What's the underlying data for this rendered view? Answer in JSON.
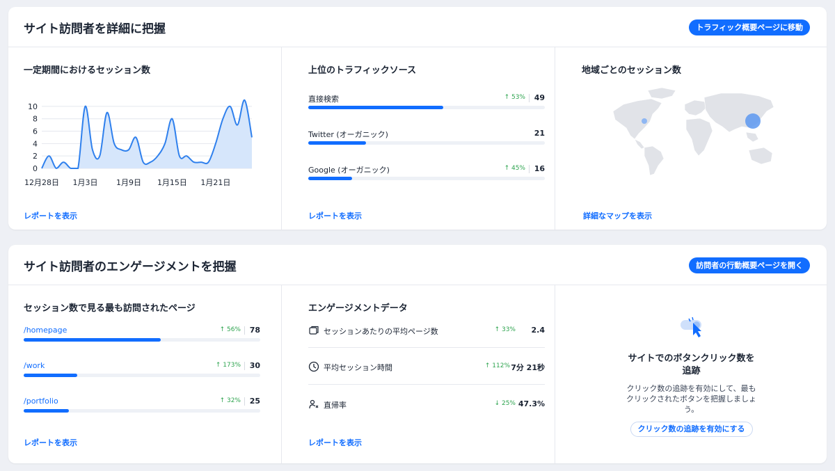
{
  "card1": {
    "title": "サイト訪問者を詳細に把握",
    "button": "トラフィック概要ページに移動",
    "sessions": {
      "title": "一定期間におけるセッション数",
      "link": "レポートを表示"
    },
    "traffic": {
      "title": "上位のトラフィックソース",
      "link": "レポートを表示",
      "rows": [
        {
          "label": "直接検索",
          "delta": "53%",
          "value": "49",
          "fill": 0.57
        },
        {
          "label": "Twitter (オーガニック)",
          "delta": "",
          "value": "21",
          "fill": 0.245
        },
        {
          "label": "Google (オーガニック)",
          "delta": "45%",
          "value": "16",
          "fill": 0.185
        }
      ]
    },
    "map": {
      "title": "地域ごとのセッション数",
      "link": "詳細なマップを表示"
    }
  },
  "card2": {
    "title": "サイト訪問者のエンゲージメントを把握",
    "button": "訪問者の行動概要ページを開く",
    "pages": {
      "title": "セッション数で見る最も訪問されたページ",
      "link": "レポートを表示",
      "rows": [
        {
          "label": "/homepage",
          "delta": "56%",
          "value": "78",
          "fill": 0.58
        },
        {
          "label": "/work",
          "delta": "173%",
          "value": "30",
          "fill": 0.225
        },
        {
          "label": "/portfolio",
          "delta": "32%",
          "value": "25",
          "fill": 0.19
        }
      ]
    },
    "engagement": {
      "title": "エンゲージメントデータ",
      "link": "レポートを表示",
      "rows": [
        {
          "icon": "pages-icon",
          "label": "セッションあたりの平均ページ数",
          "delta": "33%",
          "direction": "up",
          "value": "2.4"
        },
        {
          "icon": "clock-icon",
          "label": "平均セッション時間",
          "delta": "112%",
          "direction": "up",
          "value": "7分 21秒"
        },
        {
          "icon": "bounce-icon",
          "label": "直帰率",
          "delta": "25%",
          "direction": "down",
          "value": "47.3%"
        }
      ]
    },
    "click_tracking": {
      "title_line1": "サイトでのボタンクリック数を",
      "title_line2": "追跡",
      "desc_line1": "クリック数の追跡を有効にして、最も",
      "desc_line2": "クリックされたボタンを把握しましょ",
      "desc_line3": "う。",
      "button": "クリック数の追跡を有効にする"
    }
  },
  "colors": {
    "accent": "#116dff",
    "positive": "#2ea44f",
    "area_fill": "#d6e6fb"
  },
  "chart_data": {
    "type": "area",
    "x": [
      "12月28日",
      "12月29日",
      "12月30日",
      "12月31日",
      "1月1日",
      "1月2日",
      "1月3日",
      "1月4日",
      "1月5日",
      "1月6日",
      "1月7日",
      "1月8日",
      "1月9日",
      "1月10日",
      "1月11日",
      "1月12日",
      "1月13日",
      "1月14日",
      "1月15日",
      "1月16日",
      "1月17日",
      "1月18日",
      "1月19日",
      "1月20日",
      "1月21日",
      "1月22日",
      "1月23日",
      "1月24日",
      "1月25日",
      "1月26日"
    ],
    "values": [
      0,
      2,
      0,
      1,
      0,
      0,
      10,
      3,
      2,
      9,
      4,
      3,
      3,
      5,
      1,
      1,
      2,
      4,
      8,
      2,
      2,
      1,
      1,
      1,
      4,
      8,
      10,
      7,
      11,
      5
    ],
    "xtick_labels": [
      "12月28日",
      "1月3日",
      "1月9日",
      "1月15日",
      "1月21日"
    ],
    "yticks": [
      0,
      2,
      4,
      6,
      8,
      10
    ],
    "ylim": [
      0,
      11
    ],
    "grid": true
  }
}
